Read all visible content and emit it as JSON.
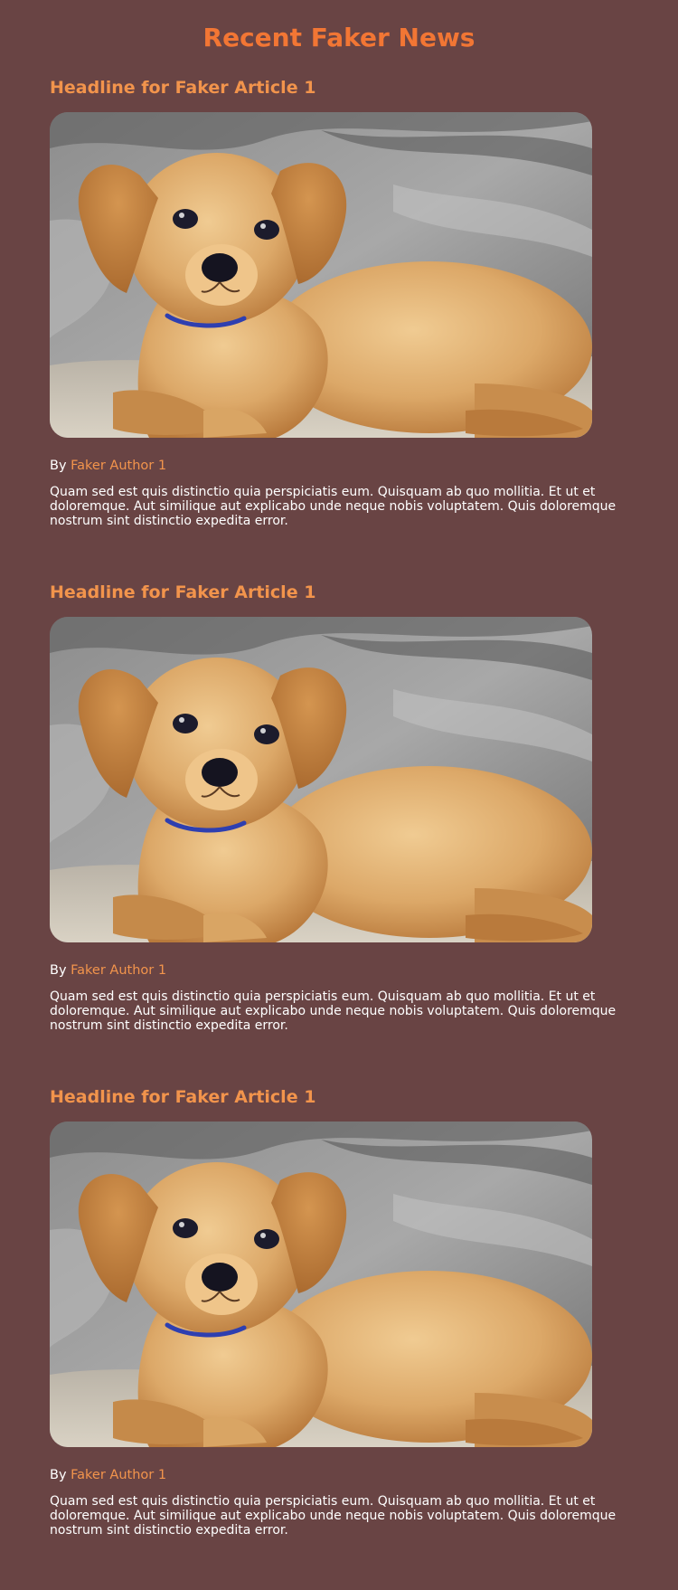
{
  "page": {
    "title": "Recent Faker News",
    "background": "#694444",
    "accent": "#f27634"
  },
  "articles": [
    {
      "headline": "Headline for Faker Article 1",
      "image": "puppy-photo",
      "by_label": "By",
      "author": "Faker Author 1",
      "summary": "Quam sed est quis distinctio quia perspiciatis eum. Quisquam ab quo mollitia. Et ut et doloremque. Aut similique aut explicabo unde neque nobis voluptatem. Quis doloremque nostrum sint distinctio expedita error."
    },
    {
      "headline": "Headline for Faker Article 1",
      "image": "puppy-photo",
      "by_label": "By",
      "author": "Faker Author 1",
      "summary": "Quam sed est quis distinctio quia perspiciatis eum. Quisquam ab quo mollitia. Et ut et doloremque. Aut similique aut explicabo unde neque nobis voluptatem. Quis doloremque nostrum sint distinctio expedita error."
    },
    {
      "headline": "Headline for Faker Article 1",
      "image": "puppy-photo",
      "by_label": "By",
      "author": "Faker Author 1",
      "summary": "Quam sed est quis distinctio quia perspiciatis eum. Quisquam ab quo mollitia. Et ut et doloremque. Aut similique aut explicabo unde neque nobis voluptatem. Quis doloremque nostrum sint distinctio expedita error."
    }
  ]
}
